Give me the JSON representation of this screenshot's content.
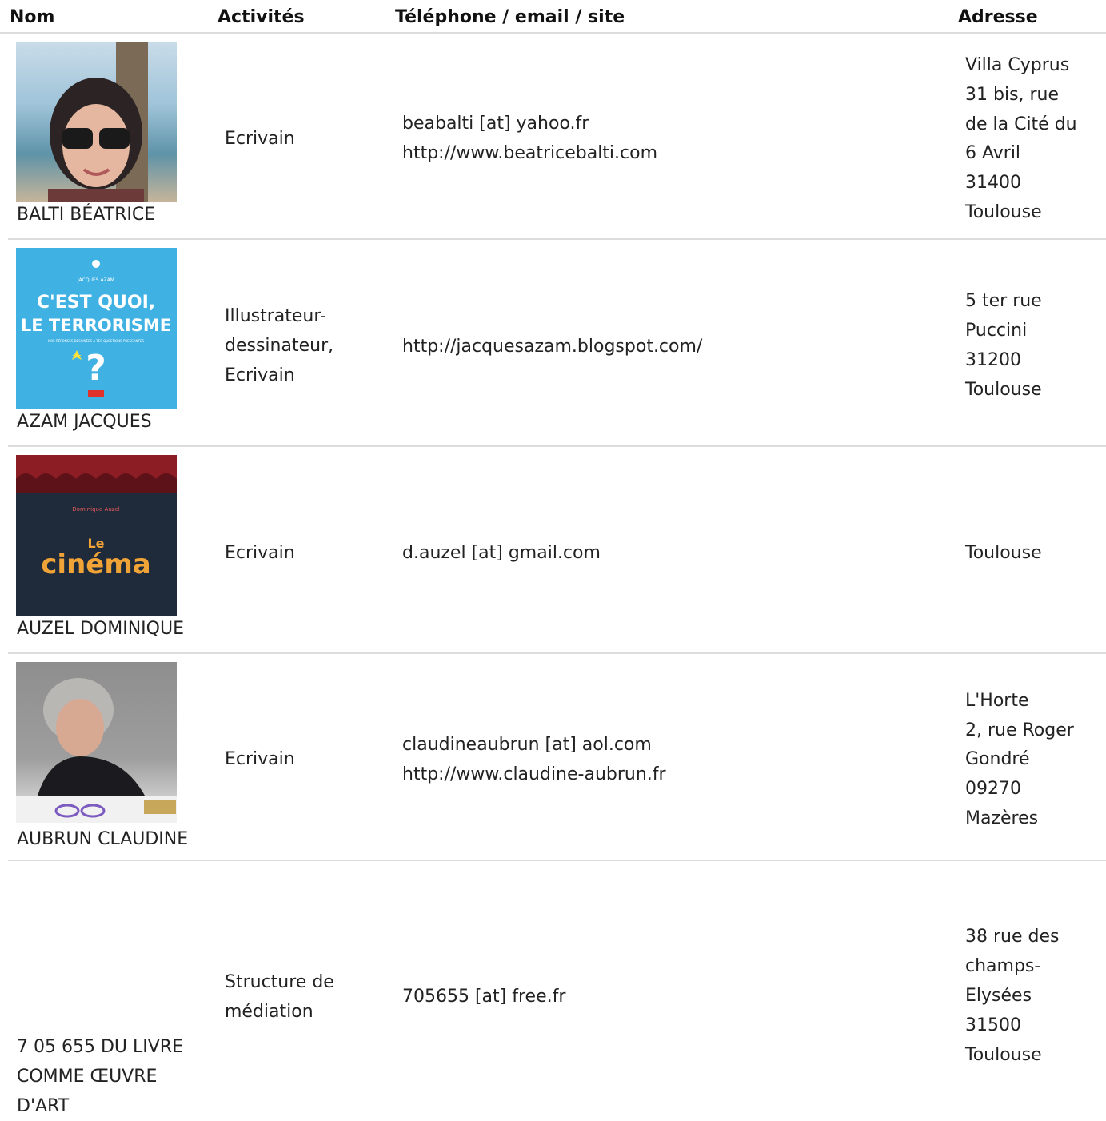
{
  "header": {
    "nom": "Nom",
    "activites": "Activités",
    "contact": "Téléphone / email / site",
    "adresse": "Adresse"
  },
  "rows": [
    {
      "name": "BALTI BÉATRICE",
      "activity": [
        "Ecrivain"
      ],
      "contact": [
        "beabalti [at] yahoo.fr",
        "http://www.beatricebalti.com"
      ],
      "address": [
        "Villa Cyprus",
        "31 bis, rue",
        "de la Cité du",
        "6 Avril",
        "31400",
        "Toulouse"
      ]
    },
    {
      "name": "AZAM JACQUES",
      "activity": [
        "Illustrateur-",
        "dessinateur,",
        "Ecrivain"
      ],
      "contact": [
        "http://jacquesazam.blogspot.com/"
      ],
      "address": [
        "5 ter rue",
        "Puccini",
        "31200",
        "Toulouse"
      ],
      "cover": {
        "author": "JACQUES AZAM",
        "title1": "C'EST QUOI,",
        "title2": "LE TERRORISME",
        "subtitle": "NOS RÉPONSES DESSINÉES À TES QUESTIONS PRESSANTES",
        "mark": "?"
      }
    },
    {
      "name": "AUZEL DOMINIQUE",
      "activity": [
        "Ecrivain"
      ],
      "contact": [
        "d.auzel [at] gmail.com"
      ],
      "address": [
        "Toulouse"
      ],
      "cover": {
        "author": "Dominique Auzel",
        "title1": "Le",
        "title2": "cinéma"
      }
    },
    {
      "name": "AUBRUN CLAUDINE",
      "activity": [
        "Ecrivain"
      ],
      "contact": [
        "claudineaubrun [at] aol.com",
        "http://www.claudine-aubrun.fr"
      ],
      "address": [
        "L'Horte",
        "2, rue Roger",
        "Gondré",
        "09270",
        "Mazères"
      ]
    },
    {
      "name_lines": [
        "7 05 655 DU LIVRE",
        "COMME ŒUVRE",
        "D'ART"
      ],
      "activity": [
        "Structure de",
        "médiation"
      ],
      "contact": [
        "705655 [at] free.fr"
      ],
      "address": [
        "38 rue des",
        "champs-",
        "Elysées",
        "31500",
        "Toulouse"
      ]
    }
  ],
  "colors": {
    "rule": "#dcdcdc",
    "text": "#222222",
    "cover_blue": "#3fb1e3",
    "cinema_orange": "#f0a336"
  },
  "icons": [
    "portrait-photo",
    "book-cover",
    "book-cover",
    "portrait-photo"
  ]
}
